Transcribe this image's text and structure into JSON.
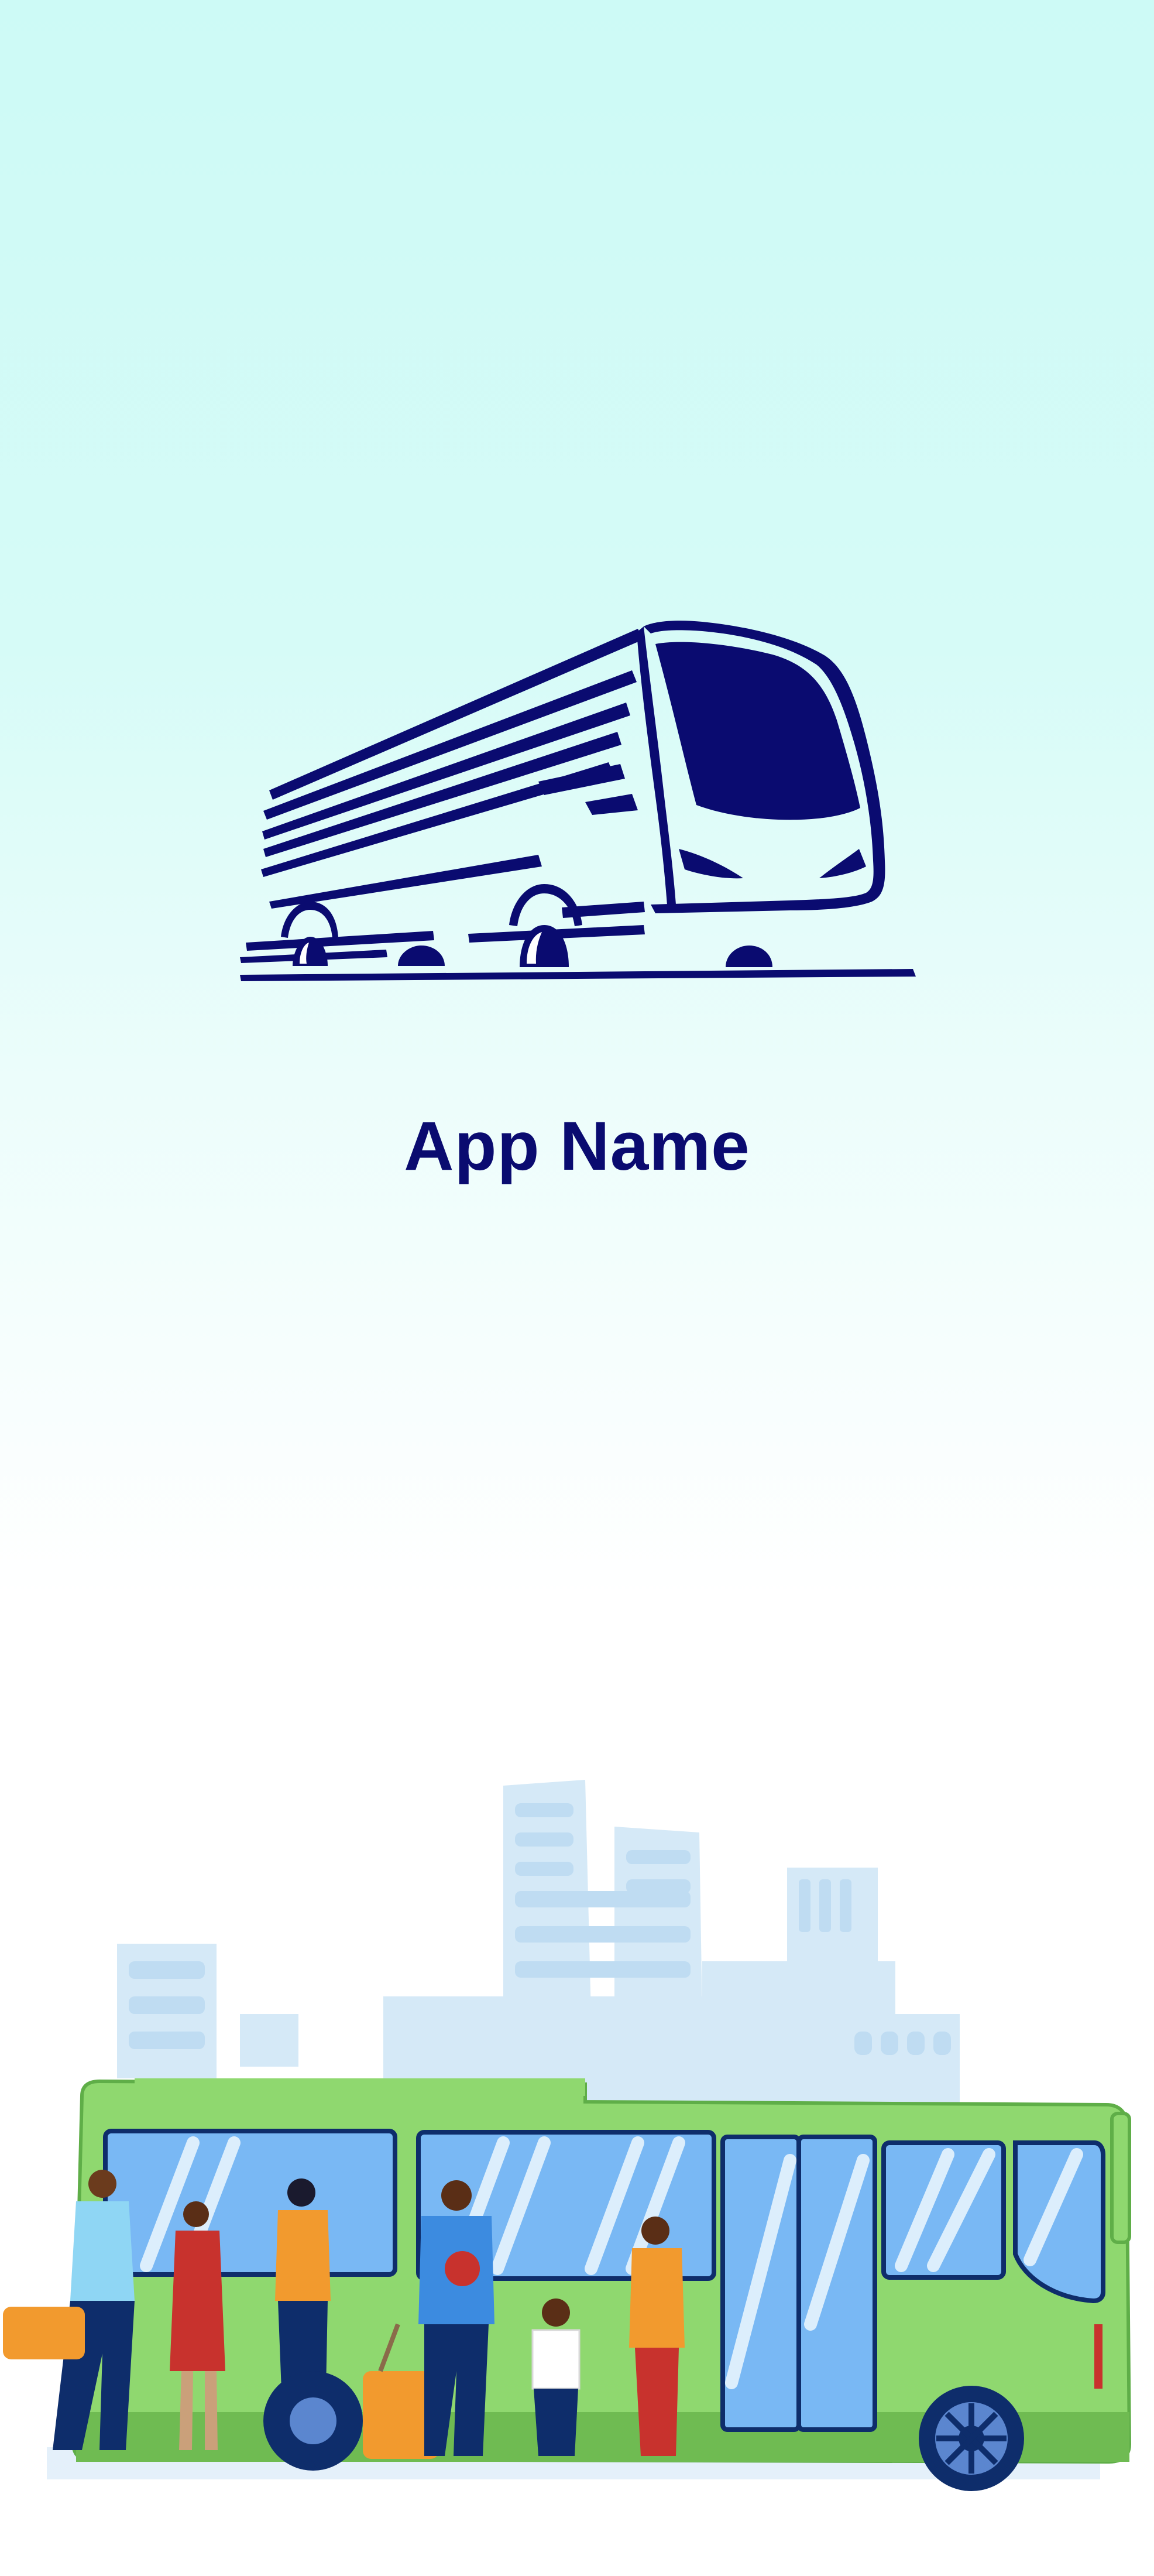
{
  "app": {
    "name": "App Name"
  },
  "logo": {
    "icon": "bus-icon",
    "color": "#0a0b70"
  },
  "illustration": {
    "icon": "bus-stop-illustration",
    "colors": {
      "bus_body": "#8fd86f",
      "bus_windows": "#79b8f4",
      "buildings": "#d5e9f7",
      "ink": "#0e2d6b",
      "orange": "#f29a2e"
    }
  },
  "background": {
    "top": "#cdfaf6",
    "bottom": "#ffffff"
  }
}
